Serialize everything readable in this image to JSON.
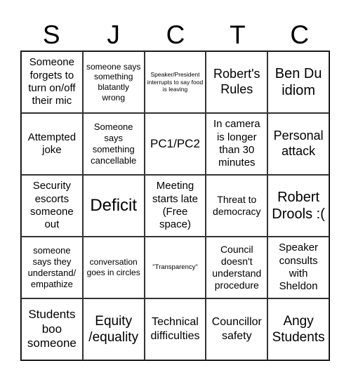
{
  "header": [
    "S",
    "J",
    "C",
    "T",
    "C"
  ],
  "cells": [
    [
      "Someone forgets to turn on/off their mic",
      "someone says something blatantly wrong",
      "Speaker/President interrupts to say food is leaving",
      "Robert's Rules",
      "Ben Du idiom"
    ],
    [
      "Attempted joke",
      "Someone says something cancellable",
      "PC1/PC2",
      "In camera is longer than 30 minutes",
      "Personal attack"
    ],
    [
      "Security escorts someone out",
      "Deficit",
      "Meeting starts late (Free space)",
      "Threat to democracy",
      "Robert Drools :("
    ],
    [
      "someone says they understand/ empathize",
      "conversation goes in circles",
      "\"Transparency\"",
      "Council doesn't understand procedure",
      "Speaker consults with Sheldon"
    ],
    [
      "Students boo someone",
      "Equity /equality",
      "Technical difficulties",
      "Councillor safety",
      "Angy Students"
    ]
  ]
}
